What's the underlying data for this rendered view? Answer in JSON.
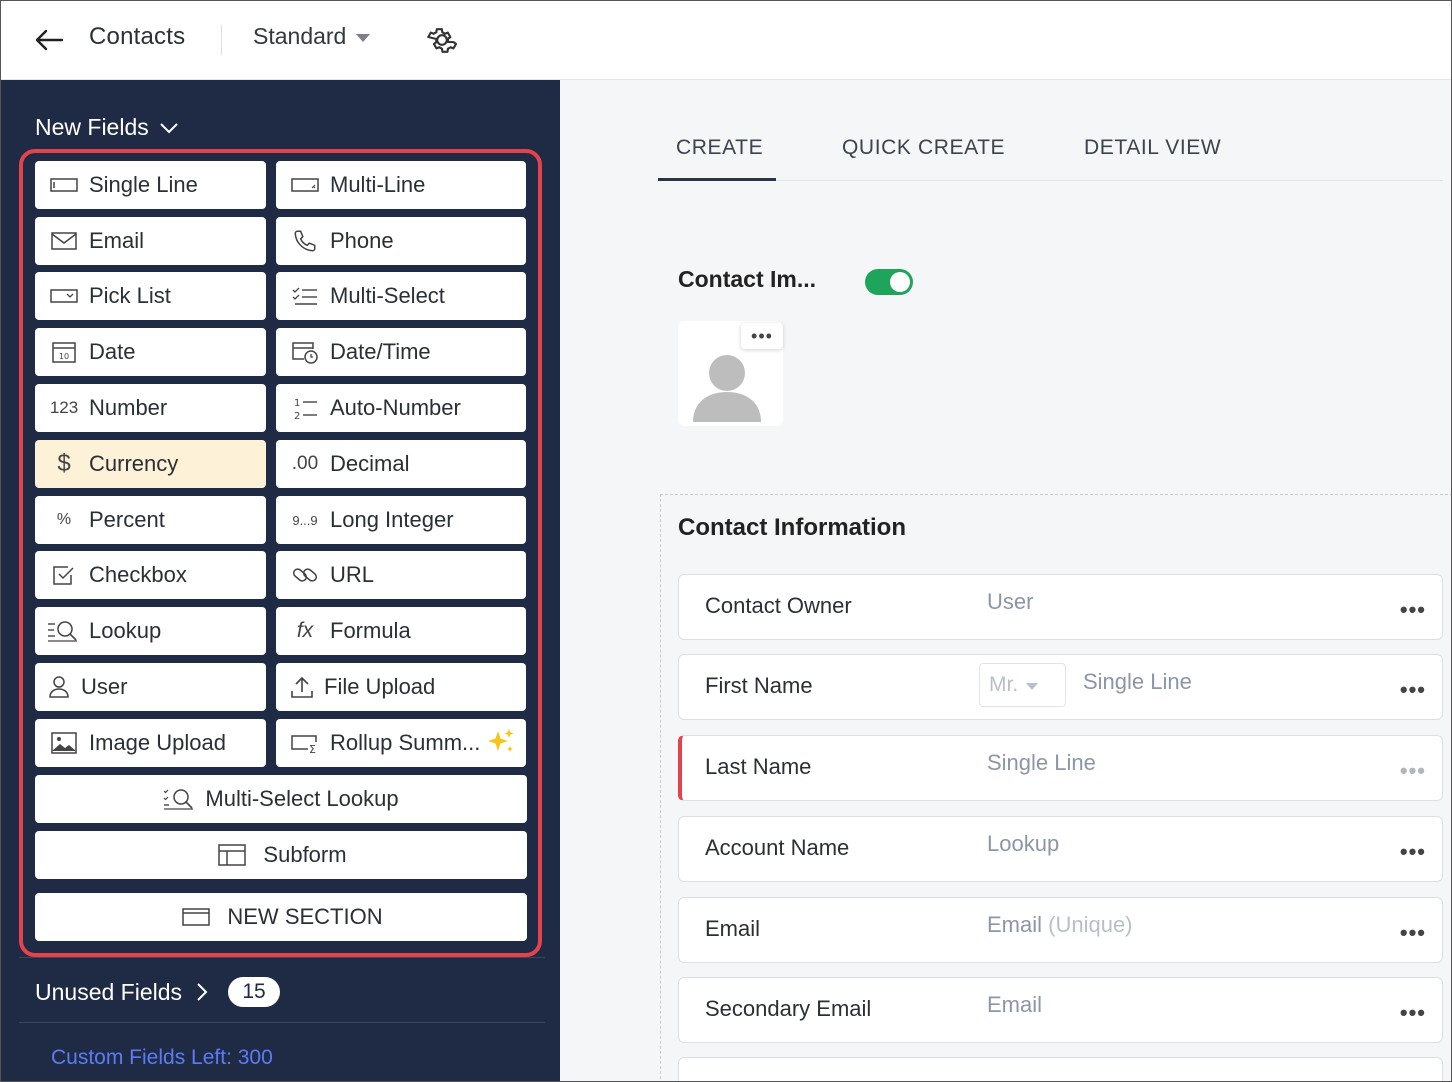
{
  "header": {
    "title": "Contacts",
    "layout": "Standard"
  },
  "sidebar": {
    "new_fields_label": "New Fields",
    "fields": [
      {
        "label": "Single Line",
        "icon": "single-line-icon"
      },
      {
        "label": "Multi-Line",
        "icon": "multi-line-icon"
      },
      {
        "label": "Email",
        "icon": "email-icon"
      },
      {
        "label": "Phone",
        "icon": "phone-icon"
      },
      {
        "label": "Pick List",
        "icon": "picklist-icon"
      },
      {
        "label": "Multi-Select",
        "icon": "multi-select-icon"
      },
      {
        "label": "Date",
        "icon": "date-icon",
        "icon_text": "10"
      },
      {
        "label": "Date/Time",
        "icon": "date-time-icon"
      },
      {
        "label": "Number",
        "icon": "number-icon",
        "icon_text": "123"
      },
      {
        "label": "Auto-Number",
        "icon": "auto-number-icon"
      },
      {
        "label": "Currency",
        "icon": "currency-icon",
        "icon_text": "$"
      },
      {
        "label": "Decimal",
        "icon": "decimal-icon",
        "icon_text": ".00"
      },
      {
        "label": "Percent",
        "icon": "percent-icon",
        "icon_text": "%"
      },
      {
        "label": "Long Integer",
        "icon": "long-integer-icon",
        "icon_text": "9...9"
      },
      {
        "label": "Checkbox",
        "icon": "checkbox-icon"
      },
      {
        "label": "URL",
        "icon": "url-icon"
      },
      {
        "label": "Lookup",
        "icon": "lookup-icon"
      },
      {
        "label": "Formula",
        "icon": "formula-icon",
        "icon_text": "fx"
      },
      {
        "label": "User",
        "icon": "user-icon"
      },
      {
        "label": "File Upload",
        "icon": "file-upload-icon"
      },
      {
        "label": "Image Upload",
        "icon": "image-upload-icon"
      },
      {
        "label": "Rollup Summ...",
        "icon": "rollup-summary-icon"
      }
    ],
    "wide_fields": [
      {
        "label": "Multi-Select Lookup",
        "icon": "multi-select-lookup-icon"
      },
      {
        "label": "Subform",
        "icon": "subform-icon"
      },
      {
        "label": "NEW SECTION",
        "icon": "new-section-icon"
      }
    ],
    "unused_fields_label": "Unused Fields",
    "unused_count": "15",
    "custom_fields_left": "Custom Fields Left: 300"
  },
  "main": {
    "tabs": [
      "CREATE",
      "QUICK CREATE",
      "DETAIL VIEW"
    ],
    "active_tab": "CREATE",
    "image_section_title": "Contact Im...",
    "avatar_menu": "•••",
    "section_title": "Contact Information",
    "rows": [
      {
        "label": "Contact Owner",
        "placeholder": "User"
      },
      {
        "label": "First Name",
        "salutation": "Mr.",
        "placeholder": "Single Line"
      },
      {
        "label": "Last Name",
        "placeholder": "Single Line",
        "required": true
      },
      {
        "label": "Account Name",
        "placeholder": "Lookup"
      },
      {
        "label": "Email",
        "placeholder": "Email",
        "placeholder_suffix": "(Unique)"
      },
      {
        "label": "Secondary Email",
        "placeholder": "Email"
      }
    ],
    "more_glyph": "•••"
  },
  "colors": {
    "sidebar_bg": "#1f2a44",
    "highlight_border": "#e5434c",
    "toggle_on": "#1fa55b",
    "currency_highlight": "#fdf1d8",
    "custom_fields_link": "#5b7cf5"
  }
}
